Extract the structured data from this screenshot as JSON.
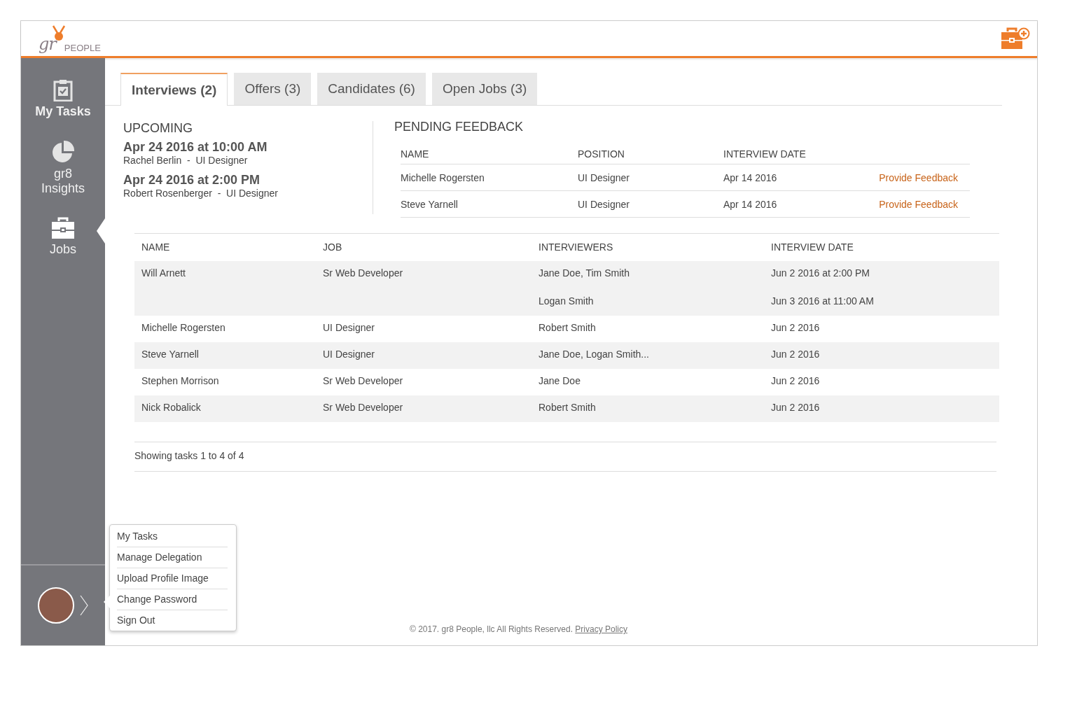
{
  "logo": {
    "script": "gr",
    "word": "PEOPLE"
  },
  "sidebar": {
    "items": [
      {
        "kind": "tasks",
        "label": "My Tasks",
        "bold": true,
        "selected": false
      },
      {
        "kind": "insights",
        "label": "gr8 Insights",
        "bold": false,
        "selected": false
      },
      {
        "kind": "jobs",
        "label": "Jobs",
        "bold": false,
        "selected": true
      }
    ]
  },
  "tabs": [
    {
      "label": "Interviews (2)",
      "selected": true
    },
    {
      "label": "Offers (3)",
      "selected": false
    },
    {
      "label": "Candidates (6)",
      "selected": false
    },
    {
      "label": "Open Jobs (3)",
      "selected": false
    }
  ],
  "upcoming": {
    "title": "UPCOMING",
    "items": [
      {
        "when": "Apr 24 2016 at 10:00 AM",
        "detail": "Rachel Berlin  -  UI Designer"
      },
      {
        "when": "Apr 24 2016 at 2:00 PM",
        "detail": "Robert Rosenberger  -  UI Designer"
      }
    ]
  },
  "pending_feedback": {
    "title": "PENDING FEEDBACK",
    "columns": [
      "NAME",
      "POSITION",
      "INTERVIEW DATE"
    ],
    "rows": [
      {
        "name": "Michelle Rogersten",
        "position": "UI Designer",
        "date": "Apr 14 2016",
        "action": "Provide Feedback"
      },
      {
        "name": "Steve Yarnell",
        "position": "UI Designer",
        "date": "Apr 14 2016",
        "action": "Provide Feedback"
      }
    ]
  },
  "table": {
    "columns": [
      "NAME",
      "JOB",
      "INTERVIEWERS",
      "INTERVIEW DATE"
    ],
    "rows": [
      {
        "name": "Will Arnett",
        "job": "Sr Web Developer",
        "interviews": [
          {
            "interviewers": "Jane Doe, Tim Smith",
            "date": "Jun 2 2016 at 2:00 PM"
          },
          {
            "interviewers": "Logan Smith",
            "date": "Jun 3 2016 at 11:00 AM"
          }
        ]
      },
      {
        "name": "Michelle Rogersten",
        "job": "UI Designer",
        "interviews": [
          {
            "interviewers": "Robert Smith",
            "date": "Jun 2 2016"
          }
        ]
      },
      {
        "name": "Steve Yarnell",
        "job": "UI Designer",
        "interviews": [
          {
            "interviewers": "Jane Doe, Logan Smith...",
            "date": "Jun 2 2016"
          }
        ]
      },
      {
        "name": "Stephen Morrison",
        "job": "Sr Web Developer",
        "interviews": [
          {
            "interviewers": "Jane Doe",
            "date": "Jun 2 2016"
          }
        ]
      },
      {
        "name": "Nick Robalick",
        "job": "Sr Web Developer",
        "interviews": [
          {
            "interviewers": "Robert Smith",
            "date": "Jun 2 2016"
          }
        ]
      }
    ]
  },
  "table_status": "Showing tasks 1 to 4 of 4",
  "user_menu": {
    "items": [
      "My Tasks",
      "Manage Delegation",
      "Upload Profile Image",
      "Change Password",
      "Sign Out"
    ]
  },
  "footer": {
    "copyright": "© 2017. gr8 People, llc All Rights Reserved.",
    "link": "Privacy Policy"
  }
}
